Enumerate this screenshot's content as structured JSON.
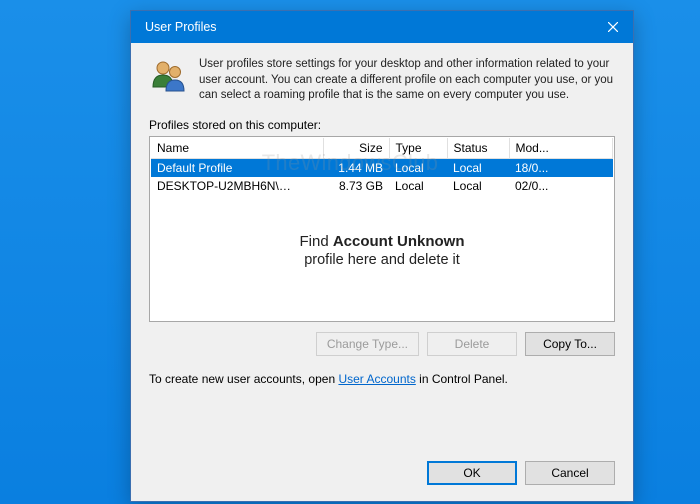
{
  "window": {
    "title": "User Profiles"
  },
  "intro": "User profiles store settings for your desktop and other information related to your user account. You can create a different profile on each computer you use, or you can select a roaming profile that is the same on every computer you use.",
  "list_label": "Profiles stored on this computer:",
  "columns": {
    "name": "Name",
    "size": "Size",
    "type": "Type",
    "status": "Status",
    "modified": "Mod..."
  },
  "rows": [
    {
      "name": "Default Profile",
      "size": "1.44 MB",
      "type": "Local",
      "status": "Local",
      "modified": "18/0...",
      "selected": true
    },
    {
      "name": "DESKTOP-U2MBH6N\\",
      "size": "8.73 GB",
      "type": "Local",
      "status": "Local",
      "modified": "02/0...",
      "selected": false,
      "name_blurred_tail": true
    }
  ],
  "annotation": {
    "line1_prefix": "Find ",
    "line1_bold": "Account Unknown",
    "line2": "profile here and delete it"
  },
  "buttons": {
    "change_type": "Change Type...",
    "delete": "Delete",
    "copy_to": "Copy To...",
    "ok": "OK",
    "cancel": "Cancel"
  },
  "footer": {
    "prefix": "To create new user accounts, open ",
    "link": "User Accounts",
    "suffix": " in Control Panel."
  },
  "watermark": "TheWindowsClub"
}
